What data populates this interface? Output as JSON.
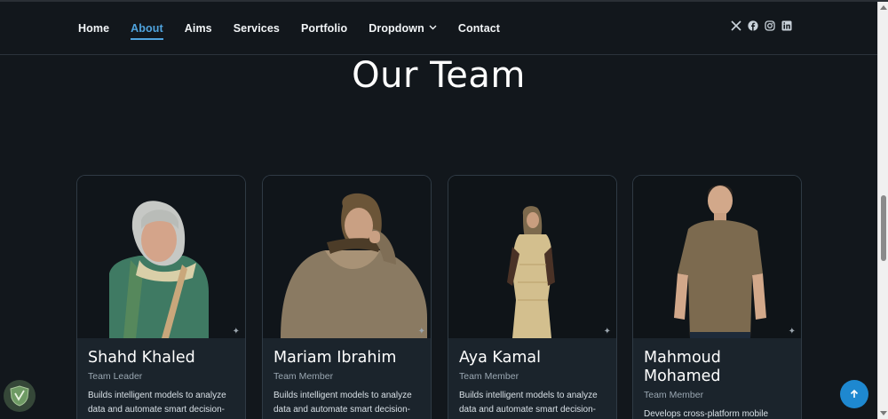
{
  "nav": {
    "items": [
      {
        "label": "Home"
      },
      {
        "label": "About"
      },
      {
        "label": "Aims"
      },
      {
        "label": "Services"
      },
      {
        "label": "Portfolio"
      },
      {
        "label": "Dropdown"
      },
      {
        "label": "Contact"
      }
    ],
    "active": "About"
  },
  "social": [
    "x-icon",
    "facebook-icon",
    "instagram-icon",
    "linkedin-icon"
  ],
  "section": {
    "title": "Our Team"
  },
  "team": [
    {
      "name": "Shahd Khaled",
      "role": "Team Leader",
      "desc": "Builds intelligent models to analyze data and automate smart decision-"
    },
    {
      "name": "Mariam Ibrahim",
      "role": "Team Member",
      "desc": "Builds intelligent models to analyze data and automate smart decision-"
    },
    {
      "name": "Aya Kamal",
      "role": "Team Member",
      "desc": "Builds intelligent models to analyze data and automate smart decision-"
    },
    {
      "name": "Mahmoud Mohamed",
      "role": "Team Member",
      "desc": "Develops cross-platform mobile"
    }
  ],
  "colors": {
    "accent": "#4fa3dd",
    "background": "#12171c",
    "card": "#1b242c",
    "button": "#1e88d0"
  }
}
